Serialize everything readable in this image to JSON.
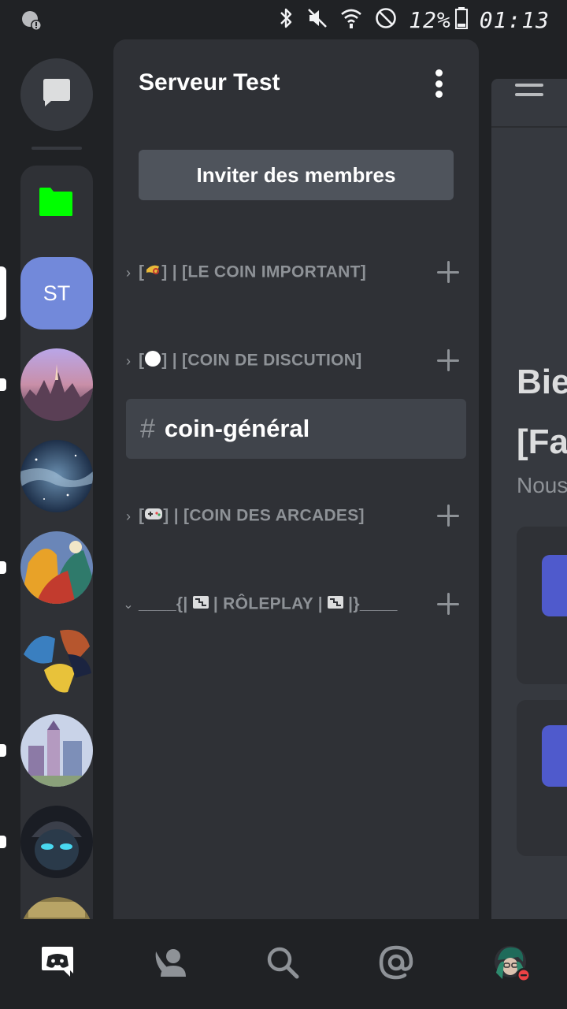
{
  "status_bar": {
    "battery": "12%",
    "time": "01:13",
    "icons": [
      "bluetooth-icon",
      "mute-icon",
      "wifi-icon",
      "do-not-disturb-icon",
      "battery-icon"
    ]
  },
  "rail": {
    "dm_icon": "chat-bubble-icon",
    "folder_color": "#00ff00",
    "selected_server_initials": "ST"
  },
  "server": {
    "name": "Serveur Test",
    "invite_label": "Inviter des membres"
  },
  "categories": [
    {
      "prefix": "[",
      "emoji": "postal-horn",
      "label": "] | [LE COIN IMPORTANT]",
      "expanded": false
    },
    {
      "prefix": "[",
      "emoji": "white-circle",
      "label": "] | [COIN DE DISCUTION]",
      "expanded": true
    },
    {
      "prefix": "[",
      "emoji": "game-controller",
      "label": "] | [COIN DES ARCADES]",
      "expanded": false
    },
    {
      "prefix": "____{| ",
      "emoji": "stairs",
      "label": " | RÔLEPLAY | ",
      "suffix": " |}____",
      "expanded": true
    }
  ],
  "channel": {
    "name": "coin-général"
  },
  "content_peek": {
    "line1": "Bie",
    "line2": "[Fa",
    "subtitle": "Nous"
  },
  "colors": {
    "accent": "#7289da",
    "panel": "#2f3136",
    "background": "#202225",
    "selected_channel": "#40444b",
    "status_dnd": "#ed4245"
  }
}
